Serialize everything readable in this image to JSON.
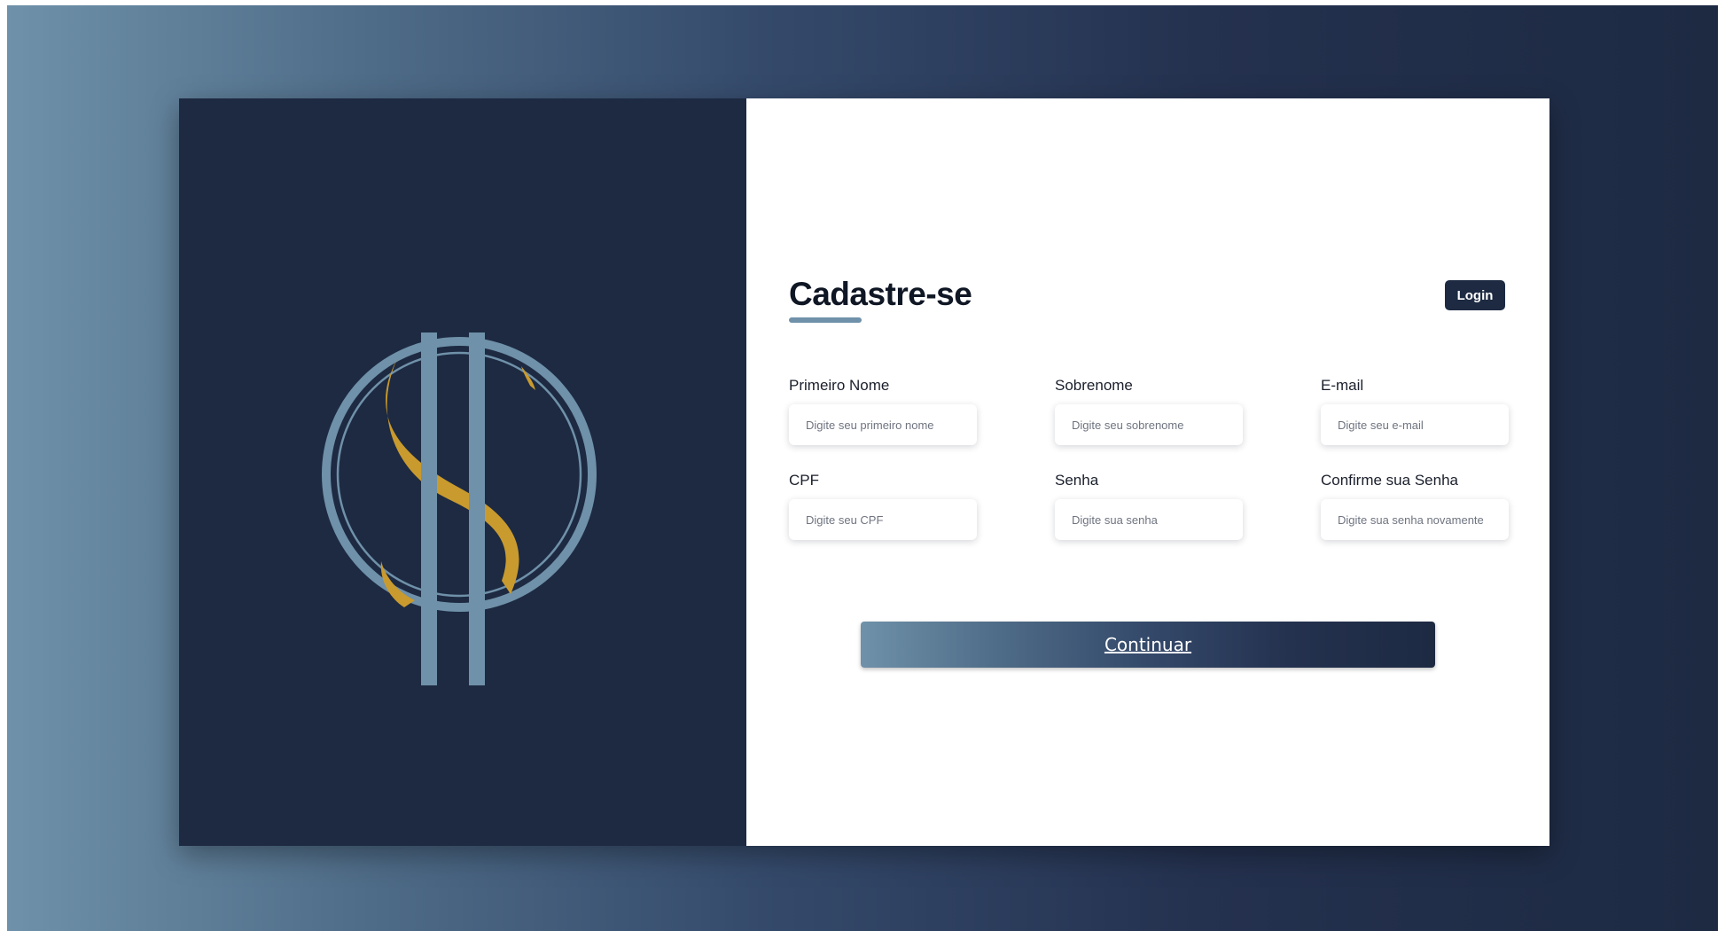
{
  "brand": {
    "logo_icon": "dollar-s-emblem-icon",
    "colors": {
      "navy": "#1d2a42",
      "steel_blue": "#6f91a9",
      "gold": "#c99a2e"
    }
  },
  "form": {
    "title": "Cadastre-se",
    "login_label": "Login",
    "fields": [
      {
        "label": "Primeiro Nome",
        "placeholder": "Digite seu primeiro nome",
        "value": ""
      },
      {
        "label": "Sobrenome",
        "placeholder": "Digite seu sobrenome",
        "value": ""
      },
      {
        "label": "E-mail",
        "placeholder": "Digite seu e-mail",
        "value": ""
      },
      {
        "label": "CPF",
        "placeholder": "Digite seu CPF",
        "value": ""
      },
      {
        "label": "Senha",
        "placeholder": "Digite sua senha",
        "value": ""
      },
      {
        "label": "Confirme sua Senha",
        "placeholder": "Digite sua senha novamente",
        "value": ""
      }
    ],
    "submit_label": "Continuar"
  }
}
